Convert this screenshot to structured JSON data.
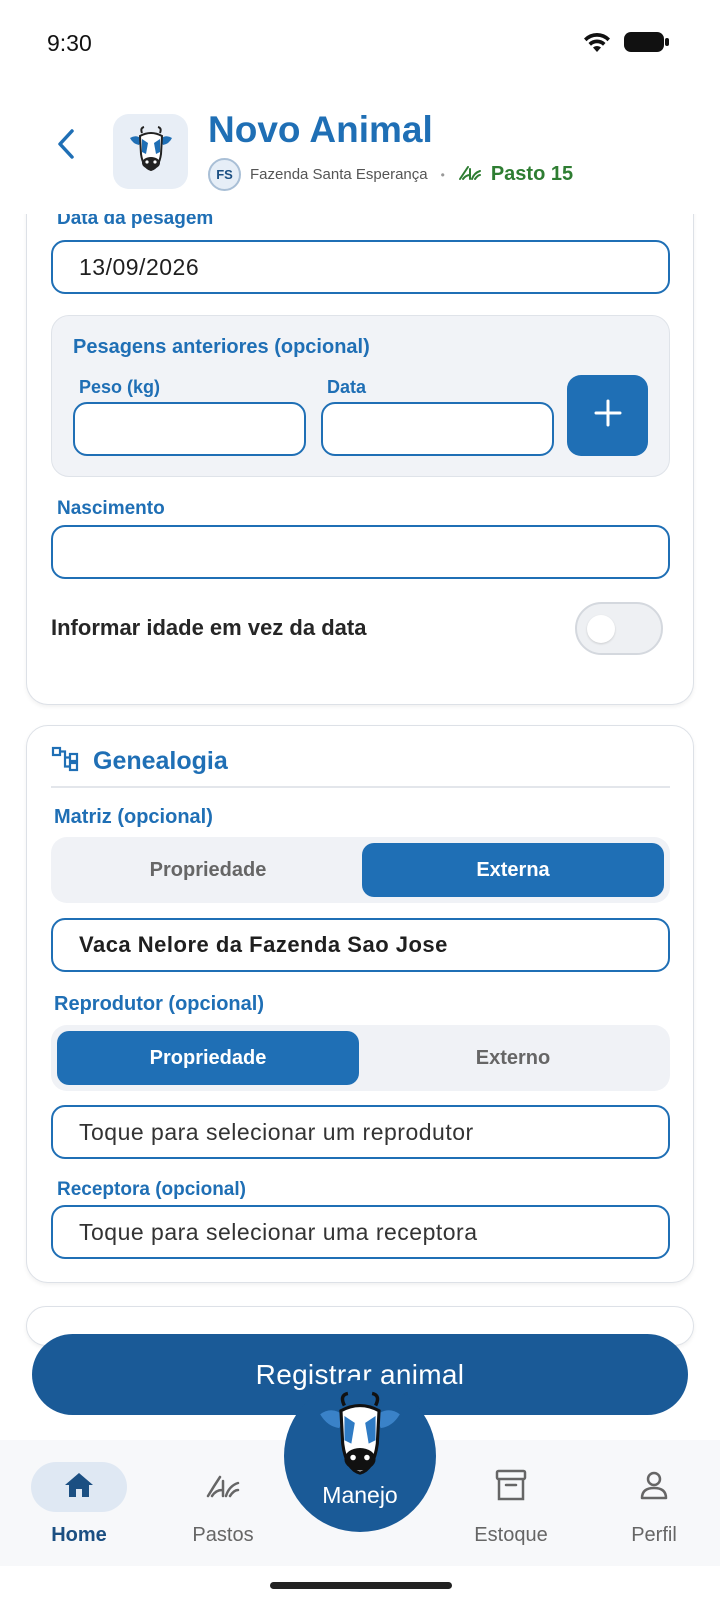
{
  "status_bar": {
    "time": "9:30"
  },
  "header": {
    "title": "Novo Animal",
    "farm_initials": "FS",
    "farm_name": "Fazenda Santa Esperança",
    "separator": "•",
    "pasture": "Pasto 15"
  },
  "form": {
    "weigh_date_label": "Data da pesagem",
    "weigh_date_value": "13/09/2026",
    "previous_weighings": {
      "title": "Pesagens anteriores (opcional)",
      "weight_label": "Peso (kg)",
      "date_label": "Data",
      "weight_value": "",
      "date_value": ""
    },
    "birth_label": "Nascimento",
    "birth_value": "",
    "age_toggle_label": "Informar idade em vez da data",
    "age_toggle_on": false
  },
  "genealogy": {
    "title": "Genealogia",
    "dam_label": "Matriz (opcional)",
    "dam_options": [
      "Propriedade",
      "Externa"
    ],
    "dam_selected": "Externa",
    "dam_value": "Vaca Nelore da Fazenda Sao Jose",
    "sire_label": "Reprodutor (opcional)",
    "sire_options": [
      "Propriedade",
      "Externo"
    ],
    "sire_selected": "Propriedade",
    "sire_placeholder": "Toque para selecionar um reprodutor",
    "recipient_label": "Receptora (opcional)",
    "recipient_placeholder": "Toque para selecionar uma receptora"
  },
  "actions": {
    "register_label": "Registrar animal"
  },
  "bottom_nav": {
    "items": [
      {
        "label": "Home",
        "icon": "home-icon",
        "active": true
      },
      {
        "label": "Pastos",
        "icon": "grass-icon",
        "active": false
      },
      {
        "label": "Manejo",
        "icon": "cow-icon",
        "active": false
      },
      {
        "label": "Estoque",
        "icon": "archive-icon",
        "active": false
      },
      {
        "label": "Perfil",
        "icon": "person-icon",
        "active": false
      }
    ]
  },
  "colors": {
    "primary": "#1f6fb5",
    "primary_dark": "#1a5a97",
    "pasture_green": "#2e7d32"
  }
}
